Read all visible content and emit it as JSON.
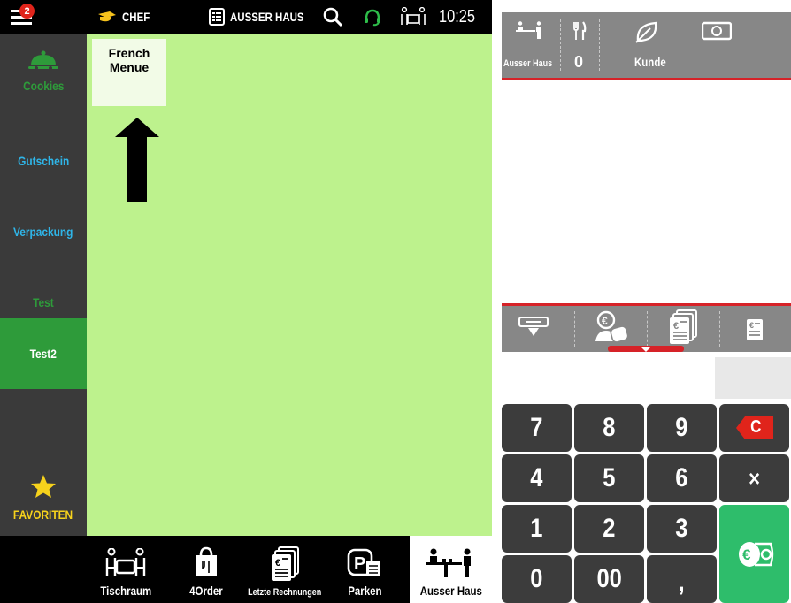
{
  "topbar": {
    "notifications": "2",
    "user": "CHEF",
    "mode": "AUSSER HAUS",
    "time": "10:25"
  },
  "sidebar": {
    "items": [
      {
        "label": "Cookies",
        "color": "#2e9b3a"
      },
      {
        "label": "Gutschein",
        "color": "#2fb5e8"
      },
      {
        "label": "Verpackung",
        "color": "#2fb5e8"
      },
      {
        "label": "Test",
        "color": "#2e9b3a"
      },
      {
        "label": "Test2",
        "color": "#ffffff"
      }
    ],
    "favorites_label": "FAVORITEN"
  },
  "main": {
    "tile": {
      "line1": "French",
      "line2": "Menue"
    }
  },
  "bottombar": {
    "items": [
      "Tischraum",
      "4Order",
      "Letzte Rechnungen",
      "Parken",
      "Ausser Haus"
    ]
  },
  "order_panel": {
    "mode_label": "Ausser Haus",
    "covers": "0",
    "customer_label": "Kunde"
  },
  "keypad": {
    "keys": [
      "7",
      "8",
      "9",
      "4",
      "5",
      "6",
      "1",
      "2",
      "3",
      "0",
      "00",
      ","
    ],
    "clear": "C",
    "multiply": "×"
  },
  "colors": {
    "accent_green": "#bdf28d",
    "sidebar_active": "#2e9b3a",
    "red": "#d62228",
    "pay_green": "#2ebd6b"
  }
}
